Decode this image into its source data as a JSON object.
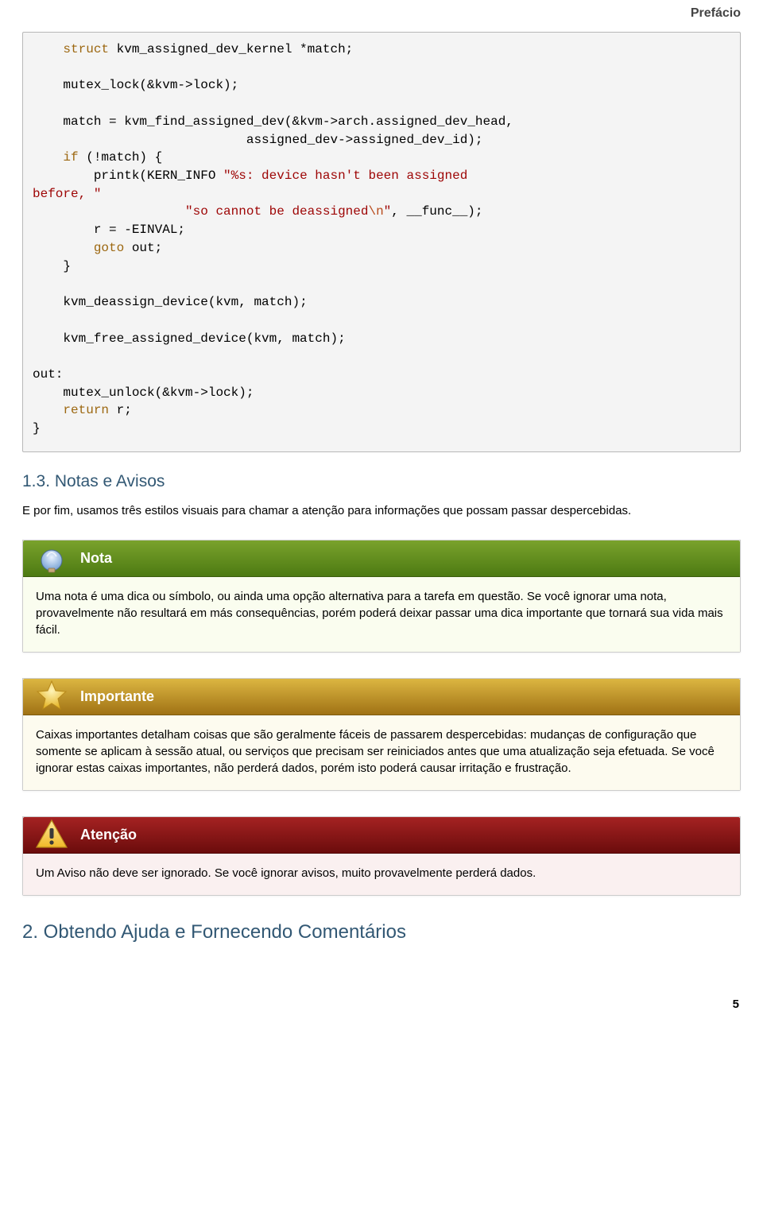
{
  "header": {
    "breadcrumb": "Prefácio"
  },
  "code": {
    "lines": [
      {
        "indent": 2,
        "tokens": [
          [
            "kw",
            "struct"
          ],
          [
            "txt",
            " kvm_assigned_dev_kernel *match;"
          ]
        ]
      },
      {
        "indent": 0,
        "tokens": []
      },
      {
        "indent": 2,
        "tokens": [
          [
            "fn",
            "mutex_lock"
          ],
          [
            "txt",
            "(&kvm->lock);"
          ]
        ]
      },
      {
        "indent": 0,
        "tokens": []
      },
      {
        "indent": 2,
        "tokens": [
          [
            "txt",
            "match = "
          ],
          [
            "fn",
            "kvm_find_assigned_dev"
          ],
          [
            "txt",
            "(&kvm->arch.assigned_dev_head,"
          ]
        ]
      },
      {
        "indent": 14,
        "tokens": [
          [
            "txt",
            "assigned_dev->assigned_dev_id);"
          ]
        ]
      },
      {
        "indent": 2,
        "tokens": [
          [
            "kw",
            "if"
          ],
          [
            "txt",
            " (!match) {"
          ]
        ]
      },
      {
        "indent": 4,
        "tokens": [
          [
            "fn",
            "printk"
          ],
          [
            "txt",
            "(KERN_INFO "
          ],
          [
            "str",
            "\"%s: device hasn't been assigned "
          ]
        ]
      },
      {
        "indent": 0,
        "tokens": [
          [
            "str",
            "before, \""
          ]
        ]
      },
      {
        "indent": 10,
        "tokens": [
          [
            "str",
            "\"so cannot be deassigned"
          ],
          [
            "op",
            "\\n"
          ],
          [
            "str",
            "\""
          ],
          [
            "txt",
            ", __func__);"
          ]
        ]
      },
      {
        "indent": 4,
        "tokens": [
          [
            "txt",
            "r = -EINVAL;"
          ]
        ]
      },
      {
        "indent": 4,
        "tokens": [
          [
            "kw",
            "goto"
          ],
          [
            "txt",
            " out;"
          ]
        ]
      },
      {
        "indent": 2,
        "tokens": [
          [
            "txt",
            "}"
          ]
        ]
      },
      {
        "indent": 0,
        "tokens": []
      },
      {
        "indent": 2,
        "tokens": [
          [
            "fn",
            "kvm_deassign_device"
          ],
          [
            "txt",
            "(kvm, match);"
          ]
        ]
      },
      {
        "indent": 0,
        "tokens": []
      },
      {
        "indent": 2,
        "tokens": [
          [
            "fn",
            "kvm_free_assigned_device"
          ],
          [
            "txt",
            "(kvm, match);"
          ]
        ]
      },
      {
        "indent": 0,
        "tokens": []
      },
      {
        "indent": 0,
        "tokens": [
          [
            "txt",
            "out:"
          ]
        ]
      },
      {
        "indent": 2,
        "tokens": [
          [
            "fn",
            "mutex_unlock"
          ],
          [
            "txt",
            "(&kvm->lock);"
          ]
        ]
      },
      {
        "indent": 2,
        "tokens": [
          [
            "kw",
            "return"
          ],
          [
            "txt",
            " r;"
          ]
        ]
      },
      {
        "indent": 0,
        "tokens": [
          [
            "txt",
            "}"
          ]
        ]
      }
    ]
  },
  "section13": {
    "heading": "1.3. Notas e Avisos",
    "intro": "E por fim, usamos três estilos visuais para chamar a atenção para informações que possam passar despercebidas."
  },
  "admon_note": {
    "title": "Nota",
    "body": "Uma nota é uma dica ou símbolo, ou ainda uma opção alternativa para a tarefa em questão. Se você ignorar uma nota, provavelmente não resultará em más consequências, porém poderá deixar passar uma dica importante que tornará sua vida mais fácil."
  },
  "admon_important": {
    "title": "Importante",
    "body": "Caixas importantes detalham coisas que são geralmente fáceis de passarem despercebidas: mudanças de configuração que somente se aplicam à sessão atual, ou serviços que precisam ser reiniciados antes que uma atualização seja efetuada. Se você ignorar estas caixas importantes, não perderá dados, porém isto poderá causar irritação e frustração."
  },
  "admon_warning": {
    "title": "Atenção",
    "body": "Um Aviso não deve ser ignorado. Se você ignorar avisos, muito provavelmente perderá dados."
  },
  "section2": {
    "heading": "2. Obtendo Ajuda e Fornecendo Comentários"
  },
  "page_number": "5"
}
